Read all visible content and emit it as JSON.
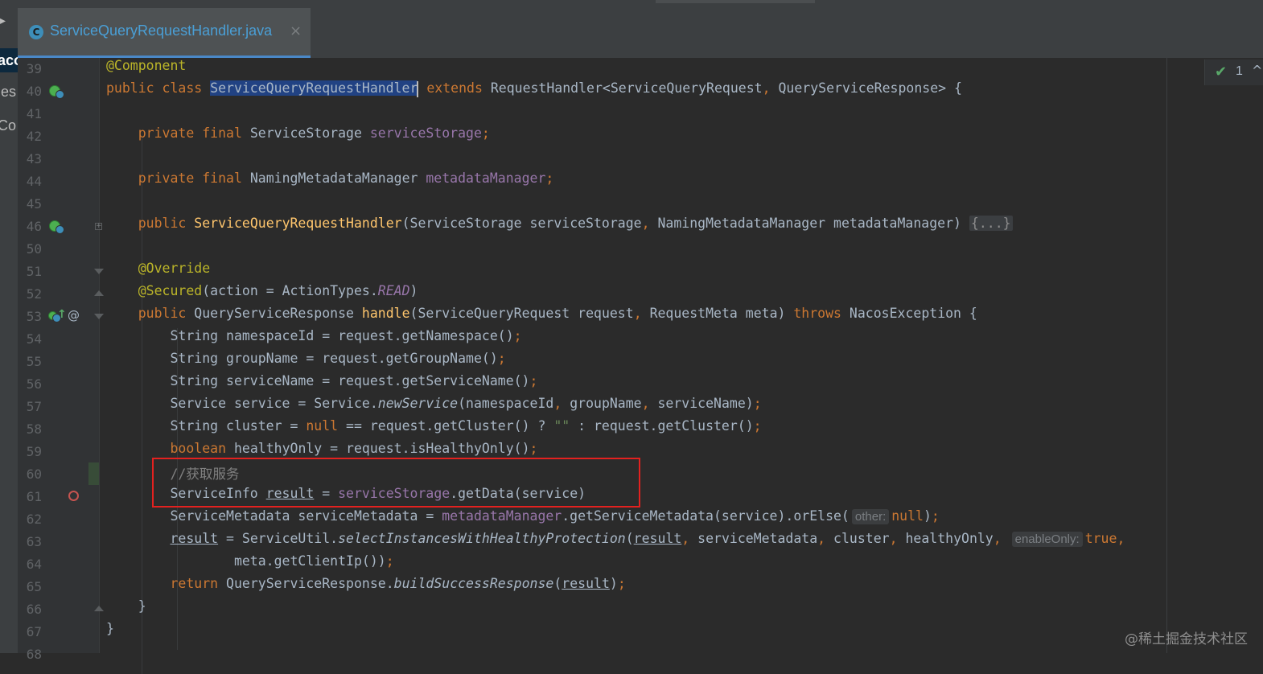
{
  "tab": {
    "icon_letter": "C",
    "filename": "ServiceQueryRequestHandler.java",
    "close_glyph": "×"
  },
  "project_sidebar": {
    "items": [
      "acos",
      "ies",
      "Co"
    ],
    "top_glyph": "▸"
  },
  "inspections": {
    "check_glyph": "✔",
    "count": "1",
    "chevron": "^"
  },
  "watermark": "@稀土掘金技术社区",
  "gutter_icons": {
    "at_symbol": "@",
    "up_arrow": "↑",
    "fold_plus": "+"
  },
  "code": {
    "line_numbers": [
      "39",
      "40",
      "41",
      "42",
      "43",
      "44",
      "45",
      "46",
      "50",
      "51",
      "52",
      "53",
      "54",
      "55",
      "56",
      "57",
      "58",
      "59",
      "60",
      "61",
      "62",
      "63",
      "64",
      "65",
      "66",
      "67",
      "68"
    ],
    "lines": [
      [
        {
          "t": "@Component",
          "c": "ann"
        }
      ],
      [
        {
          "t": "public class ",
          "c": "kw"
        },
        {
          "t": "ServiceQueryRequestHandler",
          "c": "sel"
        },
        {
          "t": "",
          "c": "caret"
        },
        {
          "t": " extends ",
          "c": "kw"
        },
        {
          "t": "RequestHandler<ServiceQueryRequest"
        },
        {
          "t": ", ",
          "c": "kw"
        },
        {
          "t": "QueryServiceResponse> {"
        }
      ],
      [],
      [
        {
          "t": "    "
        },
        {
          "t": "private final ",
          "c": "kw"
        },
        {
          "t": "ServiceStorage "
        },
        {
          "t": "serviceStorage",
          "c": "field"
        },
        {
          "t": ";",
          "c": "kw"
        }
      ],
      [],
      [
        {
          "t": "    "
        },
        {
          "t": "private final ",
          "c": "kw"
        },
        {
          "t": "NamingMetadataManager "
        },
        {
          "t": "metadataManager",
          "c": "field"
        },
        {
          "t": ";",
          "c": "kw"
        }
      ],
      [],
      [
        {
          "t": "    "
        },
        {
          "t": "public ",
          "c": "kw"
        },
        {
          "t": "ServiceQueryRequestHandler",
          "c": "fn"
        },
        {
          "t": "(ServiceStorage serviceStorage"
        },
        {
          "t": ", ",
          "c": "kw"
        },
        {
          "t": "NamingMetadataManager metadataManager) "
        },
        {
          "t": "{...}",
          "c": "fold-chip"
        }
      ],
      [],
      [
        {
          "t": "    "
        },
        {
          "t": "@Override",
          "c": "ann"
        }
      ],
      [
        {
          "t": "    "
        },
        {
          "t": "@Secured",
          "c": "ann"
        },
        {
          "t": "(action = ActionTypes."
        },
        {
          "t": "READ",
          "c": "const"
        },
        {
          "t": ")"
        }
      ],
      [
        {
          "t": "    "
        },
        {
          "t": "public ",
          "c": "kw"
        },
        {
          "t": "QueryServiceResponse "
        },
        {
          "t": "handle",
          "c": "fn"
        },
        {
          "t": "(ServiceQueryRequest request"
        },
        {
          "t": ", ",
          "c": "kw"
        },
        {
          "t": "RequestMeta meta) "
        },
        {
          "t": "throws ",
          "c": "kw"
        },
        {
          "t": "NacosException {"
        }
      ],
      [
        {
          "t": "        String namespaceId = request.getNamespace()"
        },
        {
          "t": ";",
          "c": "kw"
        }
      ],
      [
        {
          "t": "        String groupName = request.getGroupName()"
        },
        {
          "t": ";",
          "c": "kw"
        }
      ],
      [
        {
          "t": "        String serviceName = request.getServiceName()"
        },
        {
          "t": ";",
          "c": "kw"
        }
      ],
      [
        {
          "t": "        Service service = Service."
        },
        {
          "t": "newService",
          "c": "static"
        },
        {
          "t": "(namespaceId"
        },
        {
          "t": ", ",
          "c": "kw"
        },
        {
          "t": "groupName"
        },
        {
          "t": ", ",
          "c": "kw"
        },
        {
          "t": "serviceName)"
        },
        {
          "t": ";",
          "c": "kw"
        }
      ],
      [
        {
          "t": "        String cluster = "
        },
        {
          "t": "null ",
          "c": "kw"
        },
        {
          "t": "== request.getCluster() ? "
        },
        {
          "t": "\"\"",
          "c": "str"
        },
        {
          "t": " : request.getCluster()"
        },
        {
          "t": ";",
          "c": "kw"
        }
      ],
      [
        {
          "t": "        "
        },
        {
          "t": "boolean ",
          "c": "kw"
        },
        {
          "t": "healthyOnly = request.isHealthyOnly()"
        },
        {
          "t": ";",
          "c": "kw"
        }
      ],
      [
        {
          "t": "        "
        },
        {
          "t": "//获取服务",
          "c": "comment"
        }
      ],
      [
        {
          "t": "        ServiceInfo "
        },
        {
          "t": "result",
          "c": "under"
        },
        {
          "t": " = "
        },
        {
          "t": "serviceStorage",
          "c": "field"
        },
        {
          "t": ".getData(service)"
        }
      ],
      [
        {
          "t": "        ServiceMetadata serviceMetadata = "
        },
        {
          "t": "metadataManager",
          "c": "field"
        },
        {
          "t": ".getServiceMetadata(service).orElse("
        },
        {
          "t": "other:",
          "c": "hint"
        },
        {
          "t": "null",
          "c": "kw"
        },
        {
          "t": ")"
        },
        {
          "t": ";",
          "c": "kw"
        }
      ],
      [
        {
          "t": "        "
        },
        {
          "t": "result",
          "c": "under"
        },
        {
          "t": " = ServiceUtil."
        },
        {
          "t": "selectInstancesWithHealthyProtection",
          "c": "static"
        },
        {
          "t": "("
        },
        {
          "t": "result",
          "c": "under"
        },
        {
          "t": ", ",
          "c": "kw"
        },
        {
          "t": "serviceMetadata"
        },
        {
          "t": ", ",
          "c": "kw"
        },
        {
          "t": "cluster"
        },
        {
          "t": ", ",
          "c": "kw"
        },
        {
          "t": "healthyOnly"
        },
        {
          "t": ", ",
          "c": "kw"
        },
        {
          "t": "enableOnly:",
          "c": "hint"
        },
        {
          "t": "true",
          "c": "kw"
        },
        {
          "t": ",",
          "c": "kw"
        }
      ],
      [
        {
          "t": "                meta.getClientIp())"
        },
        {
          "t": ";",
          "c": "kw"
        }
      ],
      [
        {
          "t": "        "
        },
        {
          "t": "return ",
          "c": "kw"
        },
        {
          "t": "QueryServiceResponse."
        },
        {
          "t": "buildSuccessResponse",
          "c": "static"
        },
        {
          "t": "("
        },
        {
          "t": "result",
          "c": "under"
        },
        {
          "t": ")"
        },
        {
          "t": ";",
          "c": "kw"
        }
      ],
      [
        {
          "t": "    }"
        }
      ],
      [
        {
          "t": "}"
        }
      ],
      []
    ]
  }
}
